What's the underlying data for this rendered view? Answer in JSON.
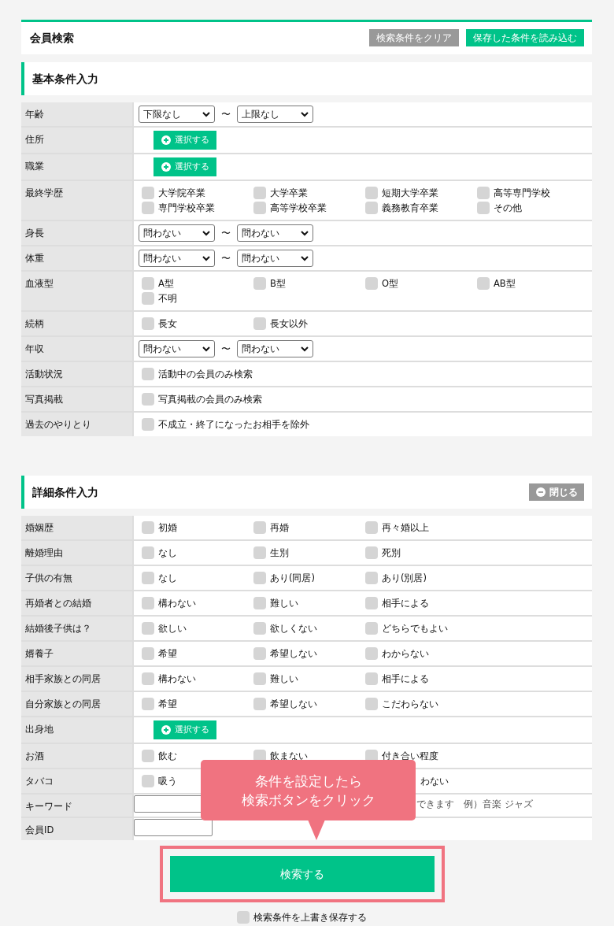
{
  "header": {
    "title": "会員検索",
    "buttons": [
      {
        "label": "検索条件をクリア",
        "kind": "clear"
      },
      {
        "label": "保存した条件を読み込む",
        "kind": "load"
      }
    ]
  },
  "basic": {
    "title": "基本条件入力",
    "rows": [
      {
        "label": "年齢",
        "kind": "range",
        "from": "下限なし",
        "to": "上限なし",
        "separator": "〜"
      },
      {
        "label": "住所",
        "kind": "picker",
        "button": "選択する"
      },
      {
        "label": "職業",
        "kind": "picker",
        "button": "選択する"
      },
      {
        "label": "最終学歴",
        "kind": "checks",
        "options": [
          {
            "label": "大学院卒業",
            "checked": false
          },
          {
            "label": "大学卒業",
            "checked": false
          },
          {
            "label": "短期大学卒業",
            "checked": false
          },
          {
            "label": "高等専門学校",
            "checked": false
          },
          {
            "label": "専門学校卒業",
            "checked": false
          },
          {
            "label": "高等学校卒業",
            "checked": false
          },
          {
            "label": "義務教育卒業",
            "checked": false
          },
          {
            "label": "その他",
            "checked": false
          }
        ]
      },
      {
        "label": "身長",
        "kind": "range",
        "from": "問わない",
        "to": "問わない",
        "separator": "〜"
      },
      {
        "label": "体重",
        "kind": "range",
        "from": "問わない",
        "to": "問わない",
        "separator": "〜"
      },
      {
        "label": "血液型",
        "kind": "checks",
        "options": [
          {
            "label": "A型",
            "checked": false
          },
          {
            "label": "B型",
            "checked": false
          },
          {
            "label": "O型",
            "checked": false
          },
          {
            "label": "AB型",
            "checked": false
          },
          {
            "label": "不明",
            "checked": false
          }
        ]
      },
      {
        "label": "続柄",
        "kind": "checks",
        "options": [
          {
            "label": "長女",
            "checked": false
          },
          {
            "label": "長女以外",
            "checked": false
          }
        ]
      },
      {
        "label": "年収",
        "kind": "range",
        "from": "問わない",
        "to": "問わない",
        "separator": "〜"
      },
      {
        "label": "活動状況",
        "kind": "checks",
        "options": [
          {
            "label": "活動中の会員のみ検索",
            "checked": false
          }
        ]
      },
      {
        "label": "写真掲載",
        "kind": "checks",
        "options": [
          {
            "label": "写真掲載の会員のみ検索",
            "checked": false
          }
        ]
      },
      {
        "label": "過去のやりとり",
        "kind": "checks",
        "options": [
          {
            "label": "不成立・終了になったお相手を除外",
            "checked": false
          }
        ]
      }
    ]
  },
  "detail": {
    "title": "詳細条件入力",
    "close_button": "閉じる",
    "rows": [
      {
        "label": "婚姻歴",
        "kind": "checks",
        "options": [
          {
            "label": "初婚",
            "checked": false
          },
          {
            "label": "再婚",
            "checked": false
          },
          {
            "label": "再々婚以上",
            "checked": false
          }
        ]
      },
      {
        "label": "離婚理由",
        "kind": "checks",
        "options": [
          {
            "label": "なし",
            "checked": false
          },
          {
            "label": "生別",
            "checked": false
          },
          {
            "label": "死別",
            "checked": false
          }
        ]
      },
      {
        "label": "子供の有無",
        "kind": "checks",
        "options": [
          {
            "label": "なし",
            "checked": false
          },
          {
            "label": "あり(同居)",
            "checked": false
          },
          {
            "label": "あり(別居)",
            "checked": false
          }
        ]
      },
      {
        "label": "再婚者との結婚",
        "kind": "checks",
        "options": [
          {
            "label": "構わない",
            "checked": false
          },
          {
            "label": "難しい",
            "checked": false
          },
          {
            "label": "相手による",
            "checked": false
          }
        ]
      },
      {
        "label": "結婚後子供は？",
        "kind": "checks",
        "options": [
          {
            "label": "欲しい",
            "checked": false
          },
          {
            "label": "欲しくない",
            "checked": false
          },
          {
            "label": "どちらでもよい",
            "checked": false
          }
        ]
      },
      {
        "label": "婿養子",
        "kind": "checks",
        "options": [
          {
            "label": "希望",
            "checked": false
          },
          {
            "label": "希望しない",
            "checked": false
          },
          {
            "label": "わからない",
            "checked": false
          }
        ]
      },
      {
        "label": "相手家族との同居",
        "kind": "checks",
        "options": [
          {
            "label": "構わない",
            "checked": false
          },
          {
            "label": "難しい",
            "checked": false
          },
          {
            "label": "相手による",
            "checked": false
          }
        ]
      },
      {
        "label": "自分家族との同居",
        "kind": "checks",
        "options": [
          {
            "label": "希望",
            "checked": false
          },
          {
            "label": "希望しない",
            "checked": false
          },
          {
            "label": "こだわらない",
            "checked": false
          }
        ]
      },
      {
        "label": "出身地",
        "kind": "picker",
        "button": "選択する"
      },
      {
        "label": "お酒",
        "kind": "checks",
        "options": [
          {
            "label": "飲む",
            "checked": false
          },
          {
            "label": "飲まない",
            "checked": false
          },
          {
            "label": "付き合い程度",
            "checked": false
          }
        ]
      },
      {
        "label": "タバコ",
        "kind": "covered_checks",
        "options": [
          {
            "label": "吸う",
            "checked": false
          }
        ],
        "trailing_text": "わない"
      },
      {
        "label": "キーワード",
        "kind": "text",
        "hint": "できます　例）音楽 ジャズ"
      },
      {
        "label": "会員ID",
        "kind": "text"
      }
    ]
  },
  "tooltip": {
    "lines": [
      "条件を設定したら",
      "検索ボタンをクリック"
    ]
  },
  "search_button": "検索する",
  "save_option": {
    "label": "検索条件を上書き保存する",
    "checked": false
  }
}
